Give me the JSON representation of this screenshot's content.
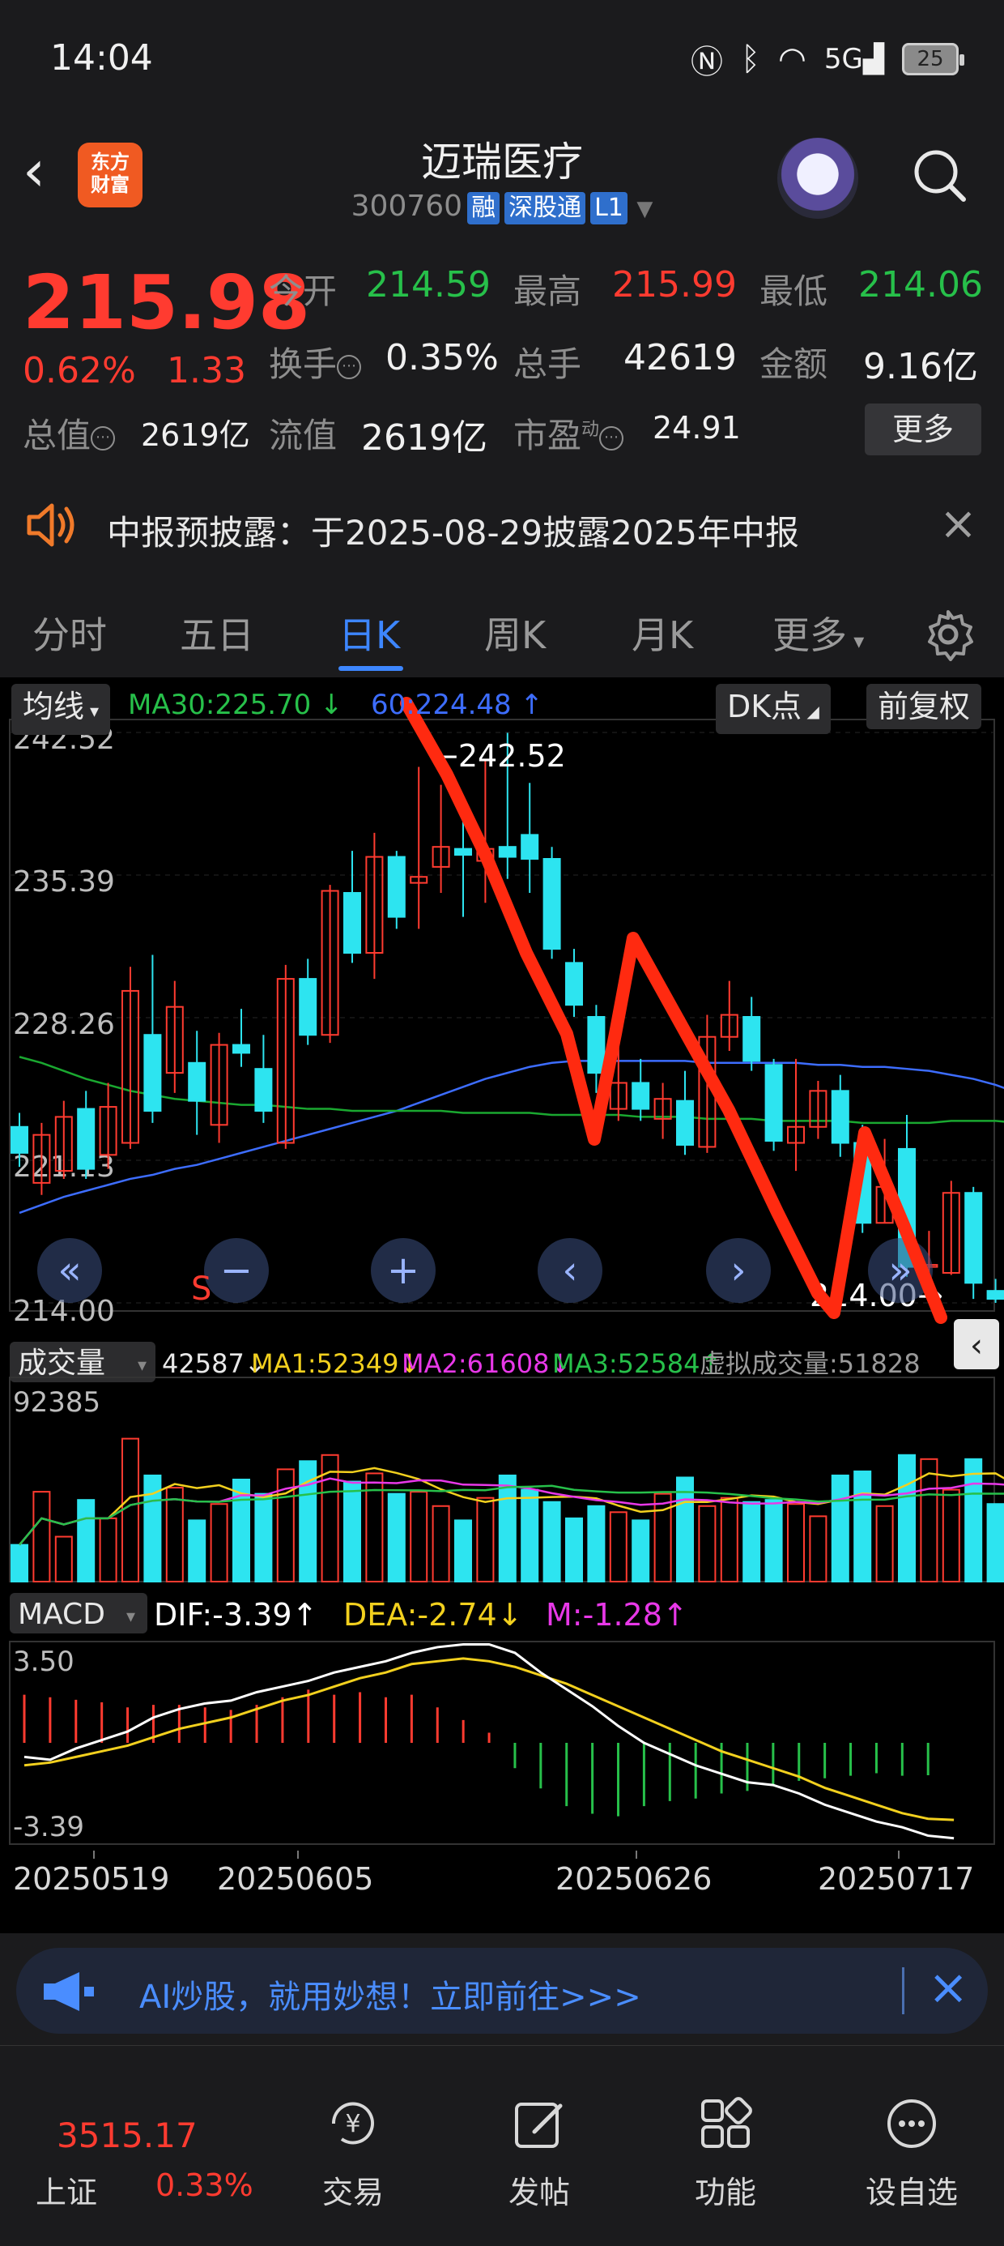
{
  "status_bar": {
    "time": "14:04",
    "battery": "25",
    "signal": "5G"
  },
  "header": {
    "title": "迈瑞医疗",
    "code": "300760",
    "tags": [
      "融",
      "深股通",
      "L1"
    ],
    "logo_text": "东方财富"
  },
  "quote": {
    "price": "215.98",
    "change_pct": "0.62%",
    "change": "1.33",
    "fields": [
      {
        "label": "今开",
        "value": "214.59",
        "color": "green"
      },
      {
        "label": "最高",
        "value": "215.99",
        "color": "red"
      },
      {
        "label": "最低",
        "value": "214.06",
        "color": "green"
      },
      {
        "label": "换手",
        "value": "0.35%",
        "color": "white"
      },
      {
        "label": "总手",
        "value": "42619",
        "color": "white"
      },
      {
        "label": "金额",
        "value": "9.16亿",
        "color": "white"
      },
      {
        "label": "总值",
        "value": "2619亿",
        "color": "white"
      },
      {
        "label": "流值",
        "value": "2619亿",
        "color": "white"
      },
      {
        "label": "市盈",
        "value": "24.91",
        "color": "white"
      }
    ],
    "pe_superscript": "动",
    "more_label": "更多"
  },
  "notice": {
    "text": "中报预披露：于2025-08-29披露2025年中报"
  },
  "tabs": [
    "分时",
    "五日",
    "日K",
    "周K",
    "月K",
    "更多"
  ],
  "active_tab": "日K",
  "kline_header": {
    "indicator_btn": "均线",
    "ma30": "MA30:225.70",
    "ma60": "60:224.48",
    "dk_btn": "DK点",
    "adjust_btn": "前复权",
    "high_label": "←242.52",
    "low_label": "214.00→"
  },
  "price_axis": [
    "242.52",
    "235.39",
    "228.26",
    "221.13",
    "214.00"
  ],
  "volume_header": {
    "btn": "成交量",
    "vol": "42587",
    "ma1": "MA1:52349",
    "ma2": "MA2:61608",
    "ma3": "MA3:52584",
    "virtual": "虚拟成交量:51828",
    "axis_top": "92385"
  },
  "macd_header": {
    "btn": "MACD",
    "dif": "DIF:-3.39",
    "dea": "DEA:-2.74",
    "m": "M:-1.28",
    "axis_top": "3.50",
    "axis_bottom": "-3.39"
  },
  "dates": [
    "20250519",
    "20250605",
    "20250626",
    "20250717"
  ],
  "chart_data": {
    "type": "candlestick",
    "y_range": [
      214.0,
      242.52
    ],
    "candles": [
      {
        "o": 222.8,
        "c": 221.5,
        "h": 223.5,
        "l": 220.8
      },
      {
        "o": 220.0,
        "c": 222.4,
        "h": 223.0,
        "l": 219.4
      },
      {
        "o": 220.6,
        "c": 223.3,
        "h": 224.1,
        "l": 220.2
      },
      {
        "o": 223.7,
        "c": 220.7,
        "h": 224.6,
        "l": 220.2
      },
      {
        "o": 221.4,
        "c": 223.8,
        "h": 225.0,
        "l": 220.7
      },
      {
        "o": 222.0,
        "c": 229.6,
        "h": 230.8,
        "l": 221.7
      },
      {
        "o": 227.4,
        "c": 223.6,
        "h": 231.4,
        "l": 223.0
      },
      {
        "o": 225.5,
        "c": 228.8,
        "h": 230.1,
        "l": 224.5
      },
      {
        "o": 226.0,
        "c": 224.1,
        "h": 227.6,
        "l": 222.4
      },
      {
        "o": 222.9,
        "c": 226.9,
        "h": 227.5,
        "l": 222.0
      },
      {
        "o": 226.9,
        "c": 226.5,
        "h": 228.7,
        "l": 225.8
      },
      {
        "o": 225.7,
        "c": 223.6,
        "h": 227.4,
        "l": 223.0
      },
      {
        "o": 222.0,
        "c": 230.2,
        "h": 230.9,
        "l": 221.7
      },
      {
        "o": 230.2,
        "c": 227.4,
        "h": 231.2,
        "l": 226.9
      },
      {
        "o": 227.4,
        "c": 234.6,
        "h": 234.9,
        "l": 227.0
      },
      {
        "o": 234.5,
        "c": 231.5,
        "h": 236.6,
        "l": 231.0
      },
      {
        "o": 231.5,
        "c": 236.3,
        "h": 237.5,
        "l": 230.2
      },
      {
        "o": 236.3,
        "c": 233.3,
        "h": 236.6,
        "l": 232.7
      },
      {
        "o": 235.0,
        "c": 235.3,
        "h": 240.8,
        "l": 232.7
      },
      {
        "o": 235.8,
        "c": 236.8,
        "h": 239.9,
        "l": 234.5
      },
      {
        "o": 236.7,
        "c": 236.4,
        "h": 238.8,
        "l": 233.3
      },
      {
        "o": 236.1,
        "c": 236.7,
        "h": 241.1,
        "l": 234.0
      },
      {
        "o": 236.8,
        "c": 236.3,
        "h": 242.5,
        "l": 235.2
      },
      {
        "o": 237.4,
        "c": 236.2,
        "h": 240.0,
        "l": 234.5
      },
      {
        "o": 236.2,
        "c": 231.7,
        "h": 236.8,
        "l": 231.2
      },
      {
        "o": 231.0,
        "c": 228.9,
        "h": 231.7,
        "l": 228.3
      },
      {
        "o": 228.3,
        "c": 225.5,
        "h": 228.9,
        "l": 224.5
      },
      {
        "o": 223.7,
        "c": 225.0,
        "h": 228.2,
        "l": 223.1
      },
      {
        "o": 225.0,
        "c": 223.7,
        "h": 226.2,
        "l": 223.1
      },
      {
        "o": 223.2,
        "c": 224.2,
        "h": 225.0,
        "l": 222.2
      },
      {
        "o": 224.1,
        "c": 221.9,
        "h": 225.6,
        "l": 221.4
      },
      {
        "o": 221.8,
        "c": 227.3,
        "h": 228.4,
        "l": 221.5
      },
      {
        "o": 227.3,
        "c": 228.4,
        "h": 230.1,
        "l": 226.6
      },
      {
        "o": 228.3,
        "c": 226.1,
        "h": 229.3,
        "l": 225.6
      },
      {
        "o": 225.9,
        "c": 222.1,
        "h": 226.2,
        "l": 221.6
      },
      {
        "o": 222.0,
        "c": 222.8,
        "h": 226.2,
        "l": 220.6
      },
      {
        "o": 222.8,
        "c": 224.6,
        "h": 225.1,
        "l": 222.2
      },
      {
        "o": 224.6,
        "c": 222.0,
        "h": 225.4,
        "l": 221.3
      },
      {
        "o": 222.0,
        "c": 218.0,
        "h": 222.9,
        "l": 217.5
      },
      {
        "o": 218.0,
        "c": 219.8,
        "h": 222.2,
        "l": 218.0
      },
      {
        "o": 221.7,
        "c": 215.8,
        "h": 223.4,
        "l": 215.3
      },
      {
        "o": 215.8,
        "c": 215.9,
        "h": 217.6,
        "l": 215.2
      },
      {
        "o": 215.5,
        "c": 219.5,
        "h": 220.1,
        "l": 215.4
      },
      {
        "o": 219.5,
        "c": 215.0,
        "h": 219.8,
        "l": 214.2
      },
      {
        "o": 214.6,
        "c": 214.2,
        "h": 215.2,
        "l": 214.0
      },
      {
        "o": 214.6,
        "c": 216.0,
        "h": 216.1,
        "l": 214.1
      }
    ],
    "ma30": [
      226.3,
      226.0,
      225.6,
      225.2,
      224.9,
      224.6,
      224.4,
      224.2,
      224.1,
      224.0,
      223.9,
      223.9,
      223.8,
      223.7,
      223.7,
      223.6,
      223.6,
      223.6,
      223.6,
      223.6,
      223.5,
      223.5,
      223.5,
      223.5,
      223.4,
      223.4,
      223.4,
      223.4,
      223.3,
      223.3,
      223.3,
      223.2,
      223.2,
      223.2,
      223.1,
      223.1,
      223.1,
      223.1,
      223.0,
      223.0,
      223.0,
      223.0,
      223.1,
      223.1,
      223.1,
      223.0
    ],
    "ma60": [
      218.5,
      218.9,
      219.3,
      219.6,
      219.9,
      220.2,
      220.4,
      220.7,
      220.9,
      221.2,
      221.5,
      221.8,
      222.1,
      222.4,
      222.7,
      223.0,
      223.3,
      223.6,
      224.0,
      224.4,
      224.8,
      225.2,
      225.5,
      225.8,
      226.0,
      226.1,
      226.1,
      226.1,
      226.1,
      226.1,
      226.1,
      226.0,
      226.0,
      226.0,
      226.0,
      226.0,
      225.9,
      225.9,
      225.8,
      225.8,
      225.7,
      225.6,
      225.4,
      225.2,
      224.9,
      224.5
    ],
    "volume": [
      18,
      44,
      22,
      40,
      31,
      70,
      52,
      46,
      30,
      38,
      50,
      43,
      55,
      59,
      62,
      49,
      53,
      43,
      44,
      37,
      30,
      41,
      52,
      45,
      39,
      31,
      37,
      34,
      30,
      43,
      51,
      37,
      41,
      39,
      40,
      38,
      32,
      52,
      54,
      37,
      62,
      60,
      45,
      60,
      38,
      31
    ],
    "volume_max": 92385,
    "macd_dif": [
      -0.5,
      -0.6,
      -0.2,
      0.1,
      0.4,
      0.9,
      1.2,
      1.4,
      1.5,
      1.8,
      2.0,
      2.2,
      2.5,
      2.7,
      2.9,
      3.2,
      3.4,
      3.5,
      3.5,
      3.2,
      2.5,
      1.9,
      1.3,
      0.6,
      0.0,
      -0.4,
      -0.8,
      -1.1,
      -1.4,
      -1.5,
      -1.8,
      -2.2,
      -2.5,
      -2.8,
      -3.0,
      -3.3,
      -3.39
    ],
    "macd_dea": [
      -0.8,
      -0.7,
      -0.5,
      -0.3,
      -0.1,
      0.2,
      0.5,
      0.7,
      0.9,
      1.2,
      1.5,
      1.7,
      2.0,
      2.3,
      2.5,
      2.8,
      2.9,
      3.0,
      2.9,
      2.7,
      2.4,
      2.1,
      1.7,
      1.3,
      0.9,
      0.5,
      0.1,
      -0.3,
      -0.6,
      -0.9,
      -1.2,
      -1.6,
      -1.9,
      -2.2,
      -2.5,
      -2.7,
      -2.74
    ],
    "macd_hist": [
      1.9,
      1.8,
      1.7,
      1.6,
      1.4,
      1.5,
      1.5,
      1.4,
      1.3,
      1.5,
      1.8,
      2.1,
      1.9,
      2.0,
      1.8,
      1.9,
      1.4,
      0.9,
      0.4,
      -1.0,
      -1.8,
      -2.5,
      -2.8,
      -2.9,
      -2.5,
      -2.3,
      -2.2,
      -2.0,
      -1.9,
      -1.7,
      -1.5,
      -1.4,
      -1.3,
      -1.2,
      -1.3,
      -1.28
    ]
  },
  "ai_banner": {
    "text": "AI炒股，就用妙想！立即前往>>>"
  },
  "bottom_nav": {
    "index_value": "3515.17",
    "index_name": "上证",
    "index_pct": "0.33%",
    "items": [
      "交易",
      "发帖",
      "功能",
      "设自选"
    ]
  },
  "controls": {
    "s_label": "S"
  }
}
